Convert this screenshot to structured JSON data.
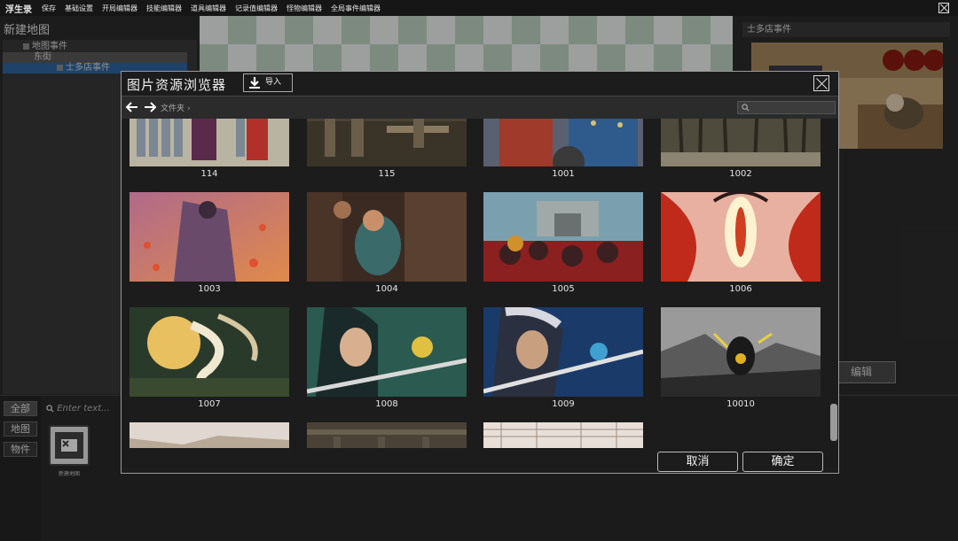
{
  "menubar": {
    "app_name": "浮生录",
    "items": [
      "保存",
      "基础设置",
      "开局编辑器",
      "技能编辑器",
      "道具编辑器",
      "记录值编辑器",
      "怪物编辑器",
      "全局事件编辑器"
    ]
  },
  "left_panel": {
    "title": "新建地图",
    "tree": [
      {
        "label": "地图事件"
      },
      {
        "label": "东街"
      },
      {
        "label": "士多店事件"
      }
    ]
  },
  "right_panel": {
    "event_name": "士多店事件",
    "edit_label": "编辑"
  },
  "bottom_panel": {
    "categories": [
      "全部",
      "地图",
      "物件"
    ],
    "search_placeholder": "Enter text...",
    "asset_label": "新建地图"
  },
  "modal": {
    "title": "图片资源浏览器",
    "import_label": "导入",
    "breadcrumb": "文件夹",
    "images": [
      {
        "id": "114"
      },
      {
        "id": "115"
      },
      {
        "id": "1001"
      },
      {
        "id": "1002"
      },
      {
        "id": "1003"
      },
      {
        "id": "1004"
      },
      {
        "id": "1005"
      },
      {
        "id": "1006"
      },
      {
        "id": "1007"
      },
      {
        "id": "1008"
      },
      {
        "id": "1009"
      },
      {
        "id": "10010"
      }
    ],
    "cancel_label": "取消",
    "confirm_label": "确定"
  }
}
